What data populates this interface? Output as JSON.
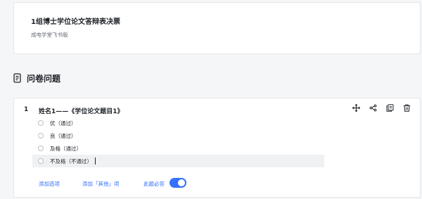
{
  "form": {
    "title": "1组博士学位论文答辩表决票",
    "subtitle": "成电学堂飞书版"
  },
  "section": {
    "title": "问卷问题",
    "icon": "questionnaire-icon"
  },
  "question": {
    "number": "1",
    "title": "姓名1——《学位论文题目1》",
    "toolbar": [
      "move-icon",
      "share-icon",
      "copy-icon",
      "delete-icon"
    ],
    "options": [
      {
        "label": "优（通过）",
        "active": false
      },
      {
        "label": "良（通过）",
        "active": false
      },
      {
        "label": "及格（通过）",
        "active": false
      },
      {
        "label": "不及格（不通过）",
        "active": true
      }
    ],
    "add_option_label": "添加选项",
    "add_other_label": "添加「其他」项",
    "required_label": "此题必答",
    "required": true
  },
  "colors": {
    "accent": "#3370ff",
    "background": "#f5f6f7",
    "card": "#ffffff"
  }
}
